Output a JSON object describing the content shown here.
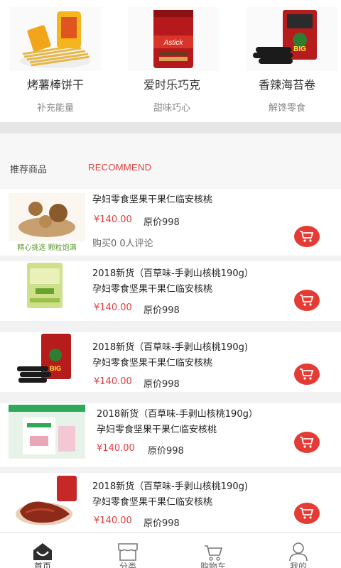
{
  "featured": [
    {
      "name": "烤薯棒饼干",
      "sub": "补充能量",
      "icon": "biscuit-sticks-image"
    },
    {
      "name": "爱时乐巧克",
      "sub": "甜味巧心",
      "icon": "astick-tin-image"
    },
    {
      "name": "香辣海苔卷",
      "sub": "解馋零食",
      "icon": "seaweed-roll-image"
    }
  ],
  "recommend": {
    "title": "推荐商品",
    "en": "RECOMMEND"
  },
  "products": [
    {
      "title": "孕妇零食坚果干果仁临安核桃",
      "price": "¥140.00",
      "orig": "原价998",
      "stats": "购买0  0人评论",
      "badge": "精心挑选  颗粒饱满"
    },
    {
      "title1": "2018新货（百草味-手剥山核桃190g）",
      "title2": "孕妇零食坚果干果仁临安核桃",
      "price": "¥140.00",
      "orig": "原价998"
    },
    {
      "title1": "2018新货（百草味-手剥山核桃190g)",
      "title2": "孕妇零食坚果干果仁临安核桃",
      "price": "¥140.00",
      "orig": "原价998"
    },
    {
      "title1": "2018新货（百草味-手剥山核桃190g）",
      "title2": "孕妇零食坚果干果仁临安核桃",
      "price": "¥140.00",
      "orig": "原价998"
    },
    {
      "title1": "2018新货（百草味-手剥山核桃190g)",
      "title2": "孕妇零食坚果干果仁临安核桃",
      "price": "¥140.00",
      "orig": "原价998"
    }
  ],
  "tabs": [
    {
      "label": "首页",
      "icon": "home-icon"
    },
    {
      "label": "分类",
      "icon": "category-shop-icon"
    },
    {
      "label": "购物车",
      "icon": "cart-icon"
    },
    {
      "label": "我的",
      "icon": "user-icon"
    }
  ],
  "colors": {
    "accent": "#e0413f",
    "cart": "#e53b35"
  }
}
